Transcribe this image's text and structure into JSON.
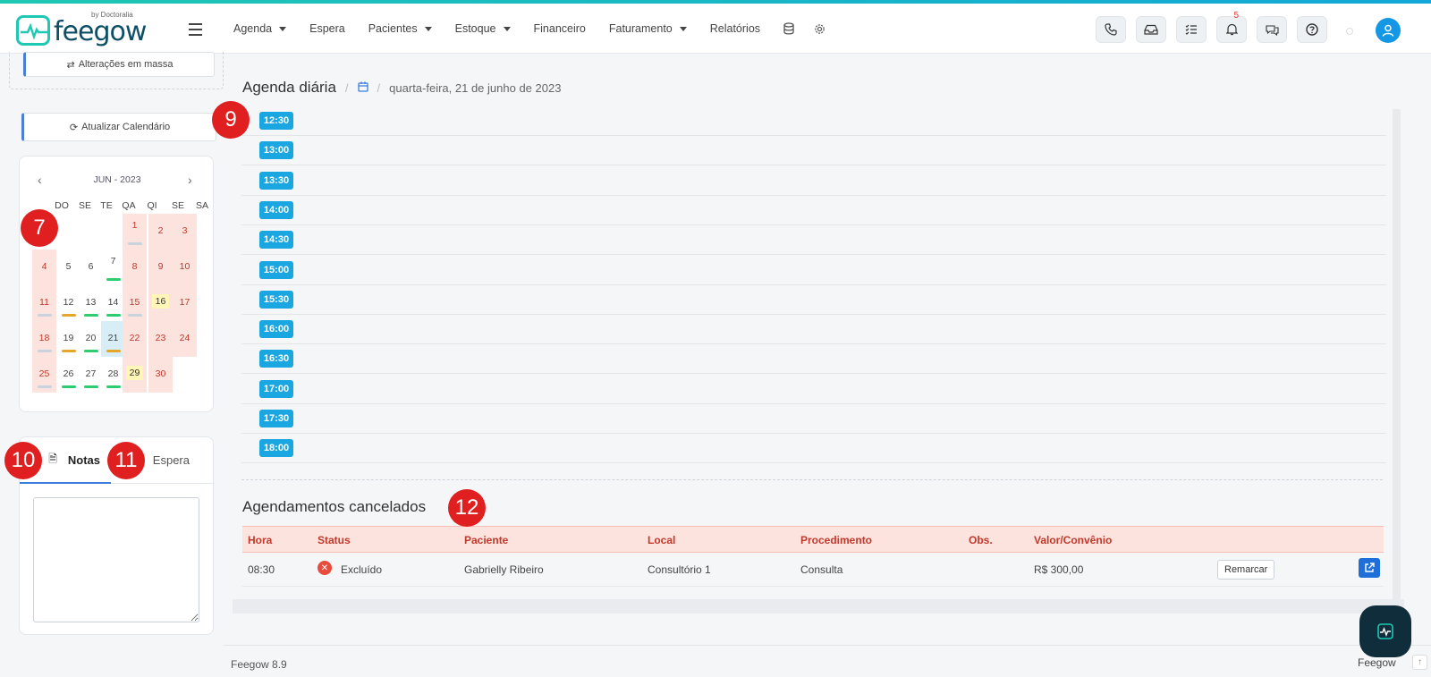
{
  "app": {
    "logo_text": "feegow",
    "logo_sub": "by Doctoralia"
  },
  "nav": {
    "items": [
      {
        "label": "Agenda",
        "caret": true
      },
      {
        "label": "Espera",
        "caret": false
      },
      {
        "label": "Pacientes",
        "caret": true
      },
      {
        "label": "Estoque",
        "caret": true
      },
      {
        "label": "Financeiro",
        "caret": false
      },
      {
        "label": "Faturamento",
        "caret": true
      },
      {
        "label": "Relatórios",
        "caret": false
      }
    ],
    "icons": [
      "database-icon",
      "settings-icon"
    ]
  },
  "topbar": {
    "actions": [
      "phone-icon",
      "inbox-icon",
      "checklist-icon",
      "bell-icon",
      "chat-icon",
      "help-icon"
    ],
    "notifications_count": "5"
  },
  "sidebar": {
    "mass_changes_label": "Alterações em massa",
    "update_calendar_label": "Atualizar Calendário",
    "calendar": {
      "month_label": "JUN - 2023",
      "weekdays": [
        "DO",
        "SE",
        "TE",
        "QA",
        "QI",
        "SE",
        "SA"
      ]
    },
    "tabs": {
      "notes_label": "Notas",
      "waiting_label": "Espera"
    }
  },
  "main": {
    "title": "Agenda diária",
    "date_label": "quarta-feira, 21 de junho de 2023",
    "time_slots": [
      "12:30",
      "13:00",
      "13:30",
      "14:00",
      "14:30",
      "15:00",
      "15:30",
      "16:00",
      "16:30",
      "17:00",
      "17:30",
      "18:00"
    ],
    "cancelled": {
      "title": "Agendamentos cancelados",
      "headers": [
        "Hora",
        "Status",
        "Paciente",
        "Local",
        "Procedimento",
        "Obs.",
        "Valor/Convênio"
      ],
      "rows": [
        {
          "hora": "08:30",
          "status": "Excluído",
          "paciente": "Gabrielly Ribeiro",
          "local": "Consultório 1",
          "procedimento": "Consulta",
          "obs": "",
          "valor": "R$ 300,00",
          "action": "Remarcar"
        }
      ]
    }
  },
  "footer": {
    "version": "Feegow 8.9",
    "brand": "Feegow"
  },
  "markers": [
    "7",
    "9",
    "10",
    "11",
    "12"
  ],
  "colors": {
    "accent": "#1aa6e0",
    "weekend": "#fde3de",
    "danger": "#e74c3c",
    "marker": "#e02020"
  }
}
